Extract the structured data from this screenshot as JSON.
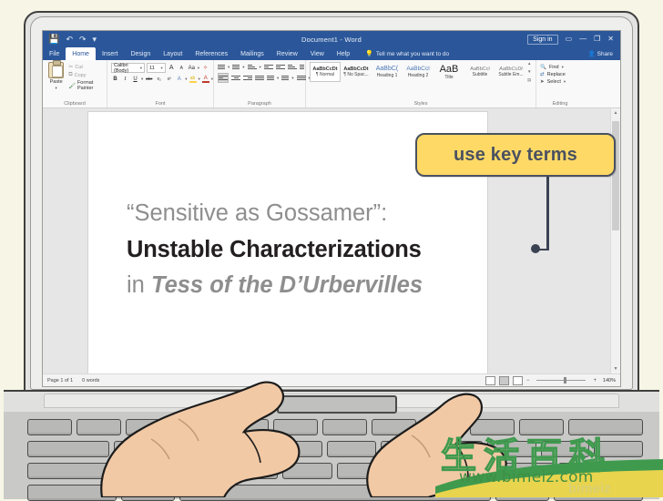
{
  "app": {
    "window_title": "Document1 - Word",
    "sign_in_label": "Sign in",
    "ribbon_display_icon": "ribbon-display-options-icon",
    "minimize_icon": "—",
    "restore_icon": "❐",
    "close_icon": "✕"
  },
  "quick_access": {
    "save_icon": "💾",
    "undo_icon": "↶",
    "redo_icon": "↷",
    "customize_icon": "▾"
  },
  "tabs": [
    {
      "label": "File",
      "active": false
    },
    {
      "label": "Home",
      "active": true
    },
    {
      "label": "Insert",
      "active": false
    },
    {
      "label": "Design",
      "active": false
    },
    {
      "label": "Layout",
      "active": false
    },
    {
      "label": "References",
      "active": false
    },
    {
      "label": "Mailings",
      "active": false
    },
    {
      "label": "Review",
      "active": false
    },
    {
      "label": "View",
      "active": false
    },
    {
      "label": "Help",
      "active": false
    }
  ],
  "tell_me": {
    "placeholder": "Tell me what you want to do",
    "icon": "lightbulb-icon"
  },
  "share": {
    "label": "Share",
    "icon": "share-person-icon"
  },
  "ribbon": {
    "clipboard": {
      "group_label": "Clipboard",
      "paste_label": "Paste",
      "cut_label": "Cut",
      "copy_label": "Copy",
      "format_painter_label": "Format Painter"
    },
    "font": {
      "group_label": "Font",
      "font_name": "Calibri (Body)",
      "font_size": "11",
      "grow_font": "A",
      "shrink_font": "A",
      "change_case": "Aa",
      "clear_formatting": "✧",
      "bold": "B",
      "italic": "I",
      "underline": "U",
      "strikethrough": "abc",
      "subscript": "x₂",
      "superscript": "x²",
      "text_effects": "A",
      "highlight": "ab",
      "font_color": "A"
    },
    "paragraph": {
      "group_label": "Paragraph"
    },
    "styles": {
      "group_label": "Styles",
      "items": [
        {
          "preview": "AaBbCcDt",
          "name": "¶ Normal",
          "selected": true
        },
        {
          "preview": "AaBbCcDt",
          "name": "¶ No Spac...",
          "selected": false
        },
        {
          "preview": "AaBbC(",
          "name": "Heading 1",
          "selected": false
        },
        {
          "preview": "AaBbCcl",
          "name": "Heading 2",
          "selected": false
        },
        {
          "preview": "AaB",
          "name": "Title",
          "selected": false
        },
        {
          "preview": "AaBbCcl",
          "name": "Subtitle",
          "selected": false
        },
        {
          "preview": "AaBbCcDt",
          "name": "Subtle Em...",
          "selected": false
        }
      ]
    },
    "editing": {
      "group_label": "Editing",
      "find_label": "Find",
      "replace_label": "Replace",
      "select_label": "Select"
    }
  },
  "document": {
    "lines": [
      {
        "text": "“Sensitive as Gossamer”:",
        "style": "gray"
      },
      {
        "text": "Unstable Characterizations",
        "style": "bold-dark"
      },
      {
        "prefix": "in ",
        "italic": "Tess of the D’Urbervilles",
        "style": "gray-italic"
      }
    ]
  },
  "status_bar": {
    "page_label": "Page 1 of 1",
    "word_count": "0 words",
    "zoom_percent": "140%",
    "zoom_out": "−",
    "zoom_in": "+"
  },
  "annotation": {
    "callout_text": "use key terms",
    "callout_fill": "#ffd966",
    "callout_border": "#4a5160",
    "connector_color": "#3b4252"
  },
  "watermark": {
    "chinese_text": "生活百科",
    "url": "www.bimeiz.com",
    "ghost_text": "bimeiz",
    "color": "#3f9a4e"
  },
  "colors": {
    "background": "#f7f6e6",
    "word_blue": "#2b579a",
    "doc_gray_text": "#8e8e8e",
    "doc_dark_text": "#231f20",
    "laptop_body": "#d8d8d6",
    "skin": "#f2c9a5"
  }
}
